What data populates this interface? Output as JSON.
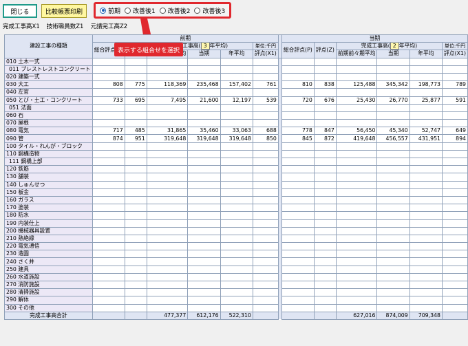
{
  "toolbar": {
    "close_label": "閉じる",
    "print_label": "比較帳票印刷"
  },
  "radios": [
    {
      "label": "前期",
      "selected": true
    },
    {
      "label": "改善後1",
      "selected": false
    },
    {
      "label": "改善後2",
      "selected": false
    },
    {
      "label": "改善後3",
      "selected": false
    }
  ],
  "tabs": [
    "完成工事高X1",
    "技術職員数Z1",
    "元請完工高Z2"
  ],
  "callout": "表示する組合せを選択",
  "table": {
    "row_header": "建設工事の種類",
    "period_prev": "前期",
    "period_curr": "当期",
    "total_eval": "総合評点(P)",
    "eval_z": "評点(Z)",
    "sales_label_prefix": "完成工事高(",
    "sales_years": "3",
    "sales_label_suffix": "年平均)",
    "curr_sales_label_prefix": "完成工事高(",
    "curr_sales_years": "2",
    "curr_sales_label_suffix": "年平均)",
    "unit": "単位:千円",
    "col_prevprev": "前期前々期平均",
    "col_curr": "当期",
    "col_prev": "前期前々期平均",
    "col_current": "当期",
    "col_avg": "年平均",
    "col_x1": "評点(X1)",
    "total_label": "完成工事高合計"
  },
  "rows": [
    {
      "name": "010 土木一式",
      "sub": false,
      "v": [
        "",
        "",
        "",
        "",
        "",
        "",
        "",
        "",
        "",
        "",
        "",
        ""
      ]
    },
    {
      "name": "011 プレストレストコンクリート",
      "sub": true,
      "v": [
        "",
        "",
        "",
        "",
        "",
        "",
        "",
        "",
        "",
        "",
        "",
        ""
      ]
    },
    {
      "name": "020 建築一式",
      "sub": false,
      "v": [
        "",
        "",
        "",
        "",
        "",
        "",
        "",
        "",
        "",
        "",
        "",
        ""
      ]
    },
    {
      "name": "030 大工",
      "sub": false,
      "v": [
        "808",
        "775",
        "118,369",
        "235,468",
        "157,402",
        "761",
        "810",
        "838",
        "125,488",
        "345,342",
        "198,773",
        "789"
      ]
    },
    {
      "name": "040 左官",
      "sub": false,
      "v": [
        "",
        "",
        "",
        "",
        "",
        "",
        "",
        "",
        "",
        "",
        "",
        ""
      ]
    },
    {
      "name": "050 とび・土工・コンクリート",
      "sub": false,
      "v": [
        "733",
        "695",
        "7,495",
        "21,600",
        "12,197",
        "539",
        "720",
        "676",
        "25,430",
        "26,770",
        "25,877",
        "591"
      ]
    },
    {
      "name": "051 法面",
      "sub": true,
      "v": [
        "",
        "",
        "",
        "",
        "",
        "",
        "",
        "",
        "",
        "",
        "",
        ""
      ]
    },
    {
      "name": "060 石",
      "sub": false,
      "v": [
        "",
        "",
        "",
        "",
        "",
        "",
        "",
        "",
        "",
        "",
        "",
        ""
      ]
    },
    {
      "name": "070 屋根",
      "sub": false,
      "v": [
        "",
        "",
        "",
        "",
        "",
        "",
        "",
        "",
        "",
        "",
        "",
        ""
      ]
    },
    {
      "name": "080 電気",
      "sub": false,
      "v": [
        "717",
        "485",
        "31,865",
        "35,460",
        "33,063",
        "688",
        "778",
        "847",
        "56,450",
        "45,340",
        "52,747",
        "649"
      ]
    },
    {
      "name": "090 管",
      "sub": false,
      "v": [
        "874",
        "951",
        "319,648",
        "319,648",
        "319,648",
        "850",
        "845",
        "872",
        "419,648",
        "456,557",
        "431,951",
        "894"
      ]
    },
    {
      "name": "100 タイル・れんが・ブロック",
      "sub": false,
      "v": [
        "",
        "",
        "",
        "",
        "",
        "",
        "",
        "",
        "",
        "",
        "",
        ""
      ]
    },
    {
      "name": "110 鋼構造物",
      "sub": false,
      "v": [
        "",
        "",
        "",
        "",
        "",
        "",
        "",
        "",
        "",
        "",
        "",
        ""
      ]
    },
    {
      "name": "111 鋼橋上部",
      "sub": true,
      "v": [
        "",
        "",
        "",
        "",
        "",
        "",
        "",
        "",
        "",
        "",
        "",
        ""
      ]
    },
    {
      "name": "120 鉄筋",
      "sub": false,
      "v": [
        "",
        "",
        "",
        "",
        "",
        "",
        "",
        "",
        "",
        "",
        "",
        ""
      ]
    },
    {
      "name": "130 舗装",
      "sub": false,
      "v": [
        "",
        "",
        "",
        "",
        "",
        "",
        "",
        "",
        "",
        "",
        "",
        ""
      ]
    },
    {
      "name": "140 しゅんせつ",
      "sub": false,
      "v": [
        "",
        "",
        "",
        "",
        "",
        "",
        "",
        "",
        "",
        "",
        "",
        ""
      ]
    },
    {
      "name": "150 板金",
      "sub": false,
      "v": [
        "",
        "",
        "",
        "",
        "",
        "",
        "",
        "",
        "",
        "",
        "",
        ""
      ]
    },
    {
      "name": "160 ガラス",
      "sub": false,
      "v": [
        "",
        "",
        "",
        "",
        "",
        "",
        "",
        "",
        "",
        "",
        "",
        ""
      ]
    },
    {
      "name": "170 塗装",
      "sub": false,
      "v": [
        "",
        "",
        "",
        "",
        "",
        "",
        "",
        "",
        "",
        "",
        "",
        ""
      ]
    },
    {
      "name": "180 防水",
      "sub": false,
      "v": [
        "",
        "",
        "",
        "",
        "",
        "",
        "",
        "",
        "",
        "",
        "",
        ""
      ]
    },
    {
      "name": "190 内装仕上",
      "sub": false,
      "v": [
        "",
        "",
        "",
        "",
        "",
        "",
        "",
        "",
        "",
        "",
        "",
        ""
      ]
    },
    {
      "name": "200 機械器具設置",
      "sub": false,
      "v": [
        "",
        "",
        "",
        "",
        "",
        "",
        "",
        "",
        "",
        "",
        "",
        ""
      ]
    },
    {
      "name": "210 熱絶縁",
      "sub": false,
      "v": [
        "",
        "",
        "",
        "",
        "",
        "",
        "",
        "",
        "",
        "",
        "",
        ""
      ]
    },
    {
      "name": "220 電気通信",
      "sub": false,
      "v": [
        "",
        "",
        "",
        "",
        "",
        "",
        "",
        "",
        "",
        "",
        "",
        ""
      ]
    },
    {
      "name": "230 造園",
      "sub": false,
      "v": [
        "",
        "",
        "",
        "",
        "",
        "",
        "",
        "",
        "",
        "",
        "",
        ""
      ]
    },
    {
      "name": "240 さく井",
      "sub": false,
      "v": [
        "",
        "",
        "",
        "",
        "",
        "",
        "",
        "",
        "",
        "",
        "",
        ""
      ]
    },
    {
      "name": "250 建具",
      "sub": false,
      "v": [
        "",
        "",
        "",
        "",
        "",
        "",
        "",
        "",
        "",
        "",
        "",
        ""
      ]
    },
    {
      "name": "260 水道施設",
      "sub": false,
      "v": [
        "",
        "",
        "",
        "",
        "",
        "",
        "",
        "",
        "",
        "",
        "",
        ""
      ]
    },
    {
      "name": "270 消防施設",
      "sub": false,
      "v": [
        "",
        "",
        "",
        "",
        "",
        "",
        "",
        "",
        "",
        "",
        "",
        ""
      ]
    },
    {
      "name": "280 清掃施設",
      "sub": false,
      "v": [
        "",
        "",
        "",
        "",
        "",
        "",
        "",
        "",
        "",
        "",
        "",
        ""
      ]
    },
    {
      "name": "290 解体",
      "sub": false,
      "v": [
        "",
        "",
        "",
        "",
        "",
        "",
        "",
        "",
        "",
        "",
        "",
        ""
      ]
    },
    {
      "name": "300 その他",
      "sub": false,
      "v": [
        "",
        "",
        "",
        "",
        "",
        "",
        "",
        "",
        "",
        "",
        "",
        ""
      ]
    }
  ],
  "totals": [
    "",
    "",
    "477,377",
    "612,176",
    "522,310",
    "",
    "",
    "",
    "627,016",
    "874,009",
    "709,348",
    ""
  ],
  "colors": {
    "accent": "#e0282e",
    "header_bg": "#dfe5f3",
    "name_bg": "#ece8f6"
  }
}
